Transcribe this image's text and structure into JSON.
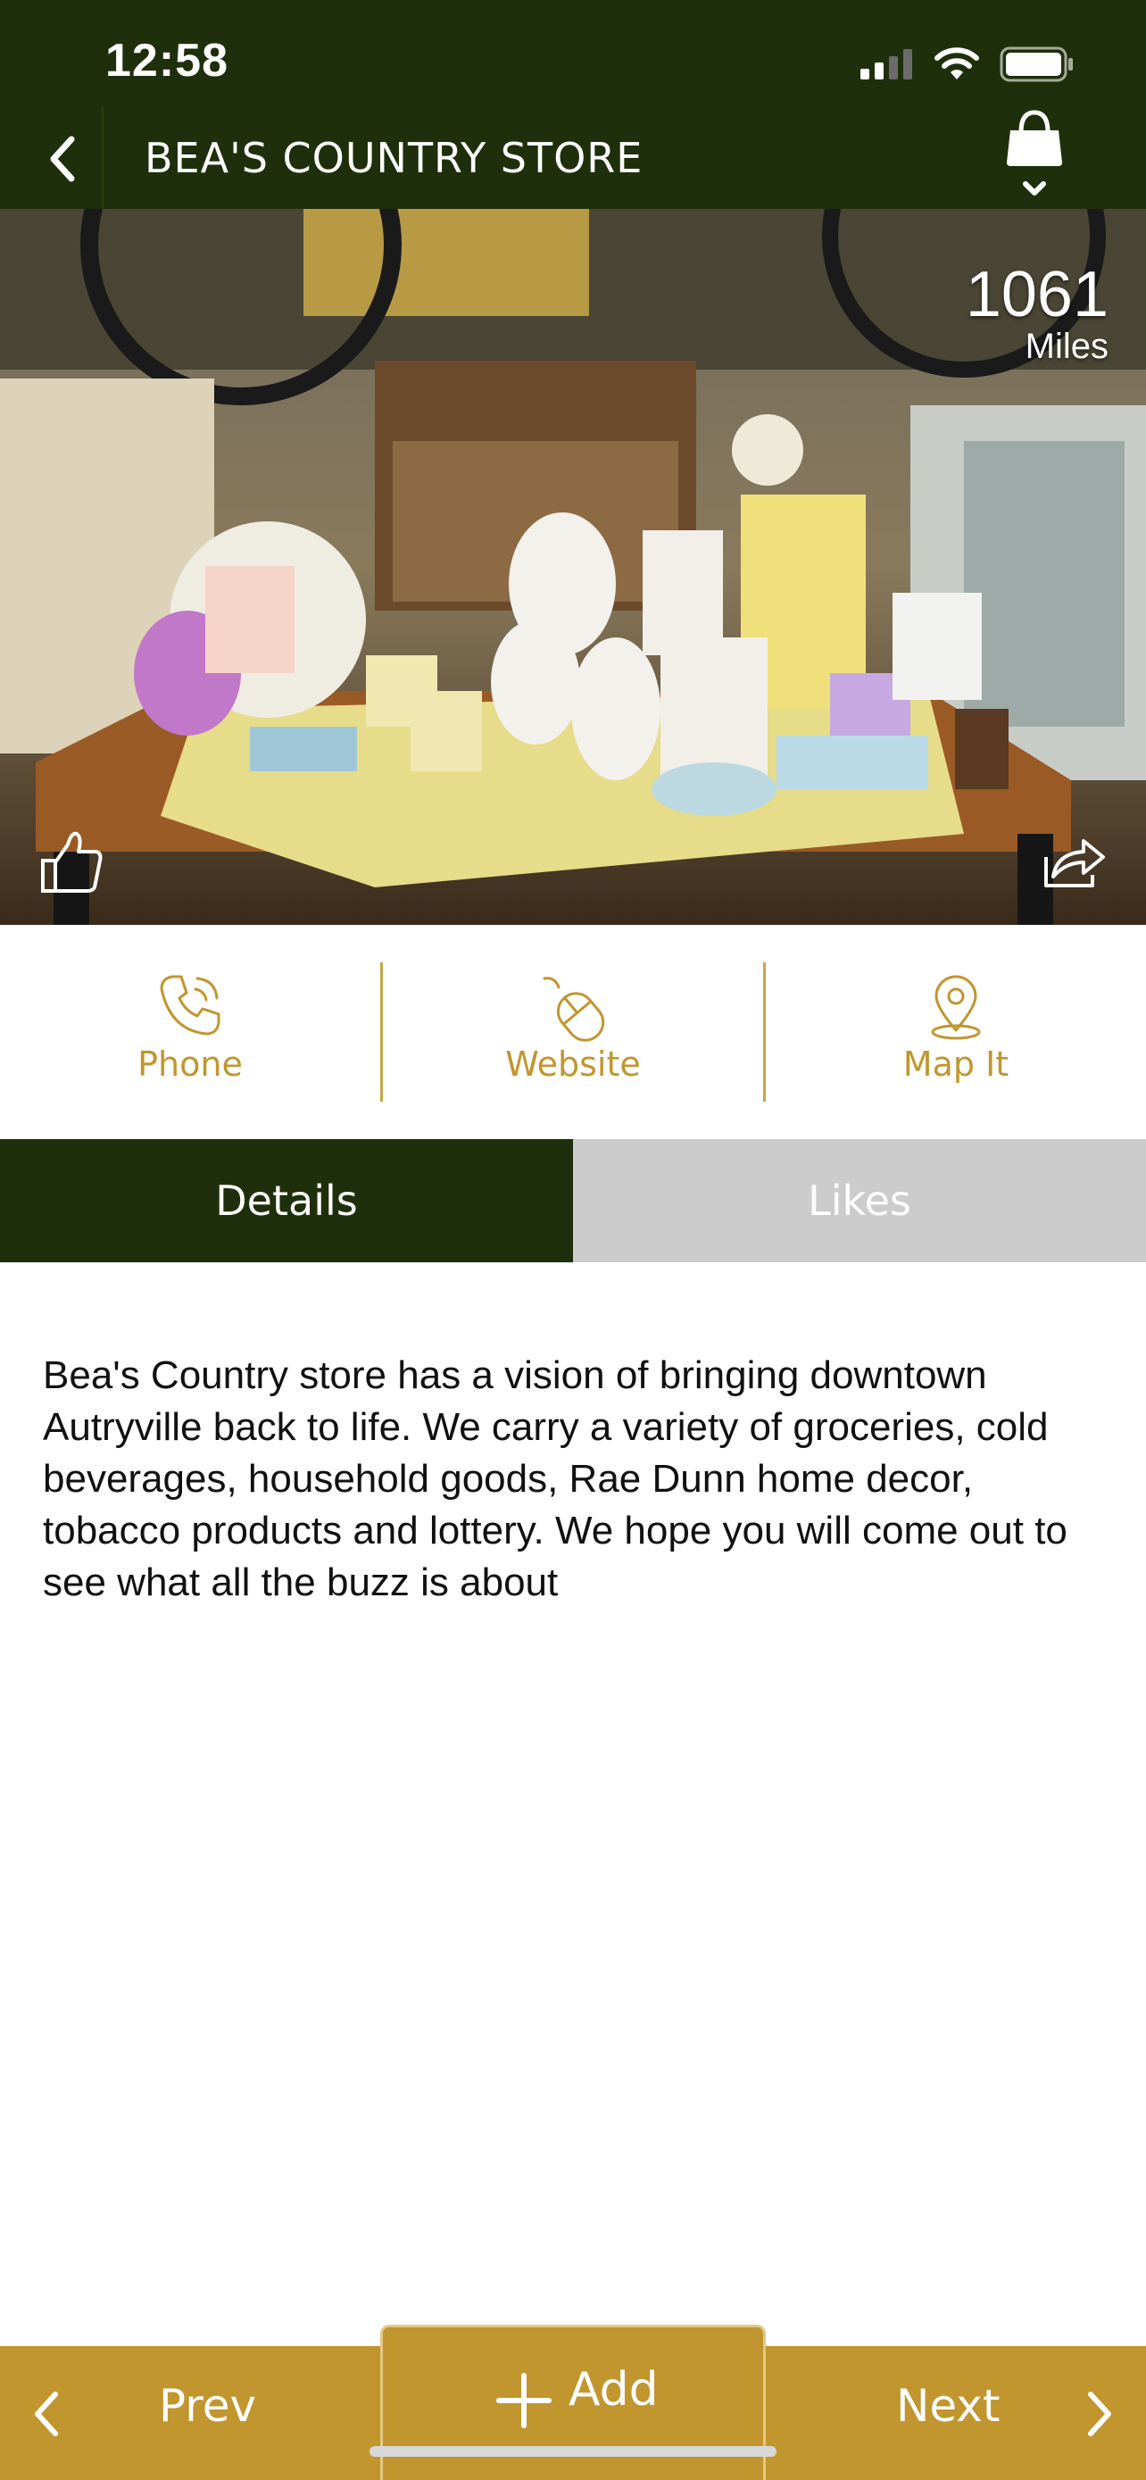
{
  "status_bar": {
    "time": "12:58"
  },
  "header": {
    "title": "BEA'S COUNTRY STORE"
  },
  "hero": {
    "distance_value": "1061",
    "distance_unit": "Miles"
  },
  "actions": [
    {
      "label": "Phone",
      "icon": "phone-icon"
    },
    {
      "label": "Website",
      "icon": "mouse-icon"
    },
    {
      "label": "Map It",
      "icon": "map-pin-icon"
    }
  ],
  "tabs": [
    {
      "label": "Details",
      "active": true
    },
    {
      "label": "Likes",
      "active": false
    }
  ],
  "details": {
    "text": "Bea's Country store has a vision of bringing downtown Autryville back to life. We carry a variety of groceries, cold beverages, household goods, Rae Dunn home decor, tobacco products and lottery. We hope you will come out to see what all the buzz is about"
  },
  "bottom_bar": {
    "prev_label": "Prev",
    "add_label": "Add",
    "next_label": "Next"
  },
  "colors": {
    "header_bg": "#1f2f0b",
    "accent_gold": "#c1962f",
    "inactive_tab": "#cccccc"
  }
}
